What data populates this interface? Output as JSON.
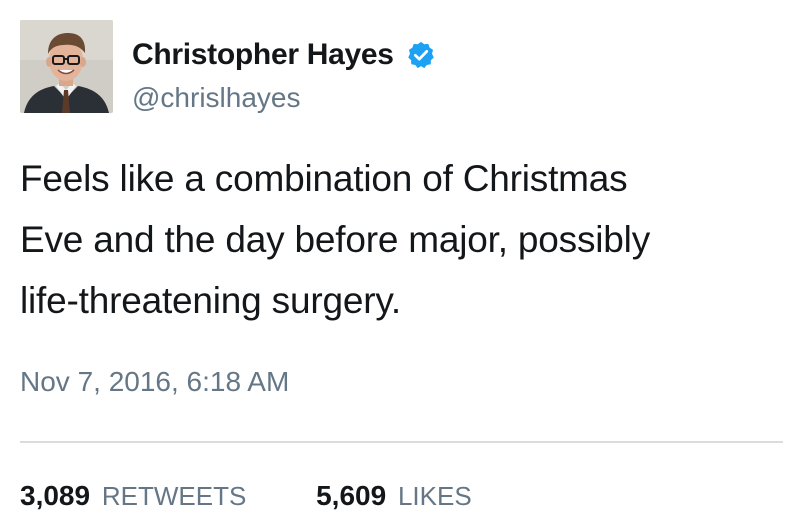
{
  "tweet": {
    "author": {
      "display_name": "Christopher Hayes",
      "handle": "@chrislhayes",
      "verified": true,
      "avatar_icon": "profile-photo",
      "verified_icon": "verified-badge-icon",
      "verified_color": "#1da1f2"
    },
    "text_lines": [
      "Feels like a combination of Christmas",
      "Eve and the day before major, possibly",
      "life-threatening surgery."
    ],
    "timestamp": "Nov 7, 2016, 6:18 AM",
    "stats": {
      "retweets_count": "3,089",
      "retweets_label": "RETWEETS",
      "likes_count": "5,609",
      "likes_label": "LIKES"
    }
  },
  "colors": {
    "text_primary": "#14171a",
    "text_secondary": "#657786",
    "divider": "#d9dde0",
    "accent": "#1da1f2"
  }
}
